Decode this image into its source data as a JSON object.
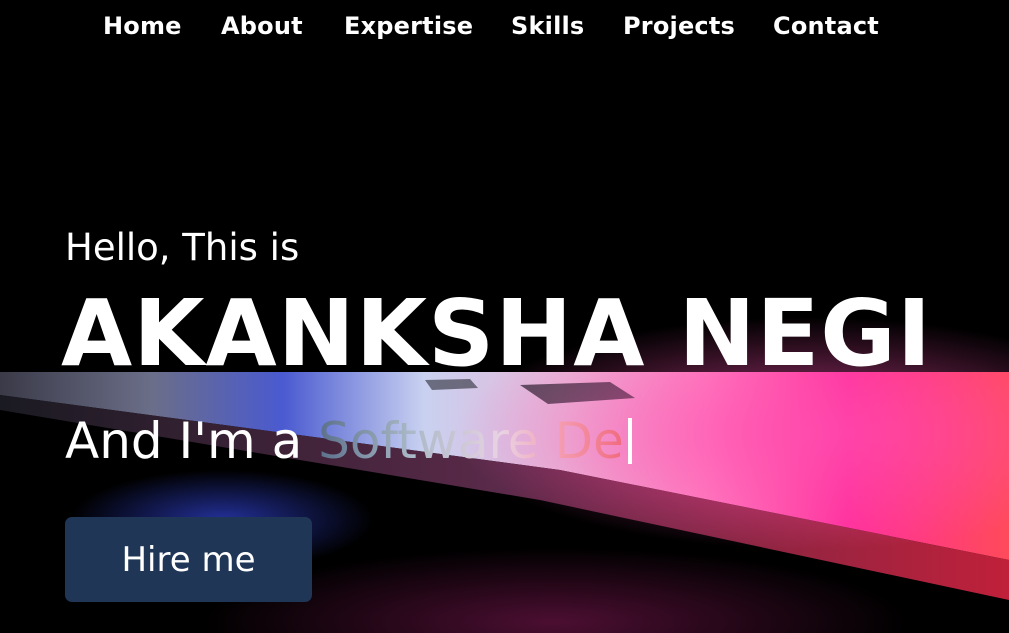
{
  "nav": {
    "items": [
      {
        "label": "Home"
      },
      {
        "label": "About"
      },
      {
        "label": "Expertise"
      },
      {
        "label": "Skills"
      },
      {
        "label": "Projects"
      },
      {
        "label": "Contact"
      }
    ]
  },
  "hero": {
    "greeting": "Hello, This is",
    "name": "AKANKSHA NEGI",
    "tagline_prefix": "And I'm a",
    "typed_text": "Software De",
    "cta_label": "Hire me"
  },
  "colors": {
    "background": "#000000",
    "text": "#ffffff",
    "button": "#1f3656",
    "accent_pink": "#ff2f9c",
    "accent_red": "#ff4a5a"
  }
}
